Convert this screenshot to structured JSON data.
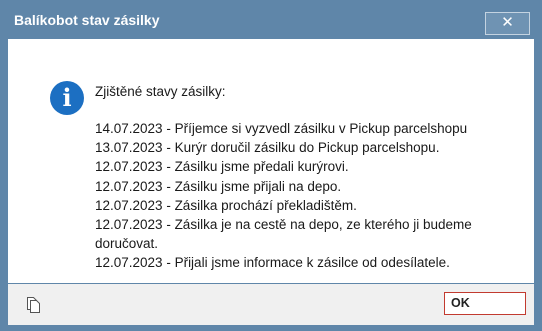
{
  "window": {
    "title": "Balíkobot stav zásilky",
    "close_label": "✕"
  },
  "message": {
    "icon": "info-icon",
    "icon_glyph": "i",
    "heading": "Zjištěné stavy zásilky:",
    "lines": [
      "14.07.2023 - Příjemce si vyzvedl zásilku v Pickup parcelshopu",
      "13.07.2023 - Kurýr doručil zásilku do Pickup parcelshopu.",
      "12.07.2023 - Zásilku jsme předali kurýrovi.",
      "12.07.2023 - Zásilku jsme přijali na depo.",
      "12.07.2023 - Zásilka prochází překladištěm.",
      "12.07.2023 - Zásilka je na cestě na depo, ze kterého ji budeme",
      "doručovat.",
      "12.07.2023 - Přijali jsme informace k zásilce od odesílatele."
    ]
  },
  "footer": {
    "copy_icon": "copy-icon",
    "ok_label": "OK"
  },
  "colors": {
    "titlebar": "#5f86a9",
    "info_icon": "#1c6fc2",
    "ok_border": "#c23a2f"
  }
}
